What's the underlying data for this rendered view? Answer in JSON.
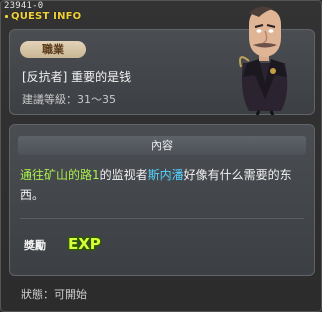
{
  "header": {
    "quest_id": "23941-0",
    "title": "QUEST INFO"
  },
  "quest": {
    "job_badge": "職業",
    "name": "[反抗者] 重要的是钱",
    "level": "建議等級：31～35"
  },
  "content": {
    "header": "內容",
    "part1": "通往矿山的路1",
    "part2": "的监视者",
    "part3": "斯内潘",
    "part4": "好像有什么需要的东西。"
  },
  "reward": {
    "label": "獎勵",
    "exp_label": "EXP"
  },
  "status": "狀態：可開始",
  "colors": {
    "title": "#f1d23a",
    "highlight_green": "#a8f04a",
    "highlight_cyan": "#54d4ff"
  }
}
